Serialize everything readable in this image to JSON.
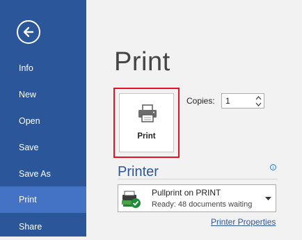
{
  "sidebar": {
    "back_icon": "back-arrow-icon",
    "items": [
      {
        "label": "Info"
      },
      {
        "label": "New"
      },
      {
        "label": "Open"
      },
      {
        "label": "Save"
      },
      {
        "label": "Save As"
      },
      {
        "label": "Print",
        "active": true
      },
      {
        "label": "Share"
      }
    ]
  },
  "main": {
    "title": "Print",
    "print_button": {
      "label": "Print",
      "icon": "printer-icon"
    },
    "copies": {
      "label": "Copies:",
      "value": "1"
    },
    "printer_section": {
      "title": "Printer",
      "info_icon": "info-icon",
      "selected_printer": {
        "name": "Pullprint on PRINT",
        "status": "Ready: 48 documents waiting",
        "icon": "printer-ready-icon"
      },
      "properties_link": "Printer Properties"
    }
  },
  "colors": {
    "sidebar_bg": "#2b579a",
    "sidebar_active": "#4472c4",
    "accent": "#2b579a",
    "highlight_border": "#e81123"
  }
}
